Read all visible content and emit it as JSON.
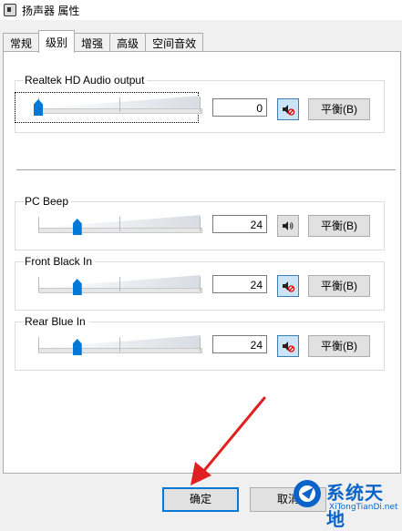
{
  "window": {
    "title": "扬声器 属性"
  },
  "tabs": [
    {
      "label": "常规"
    },
    {
      "label": "级别"
    },
    {
      "label": "增强"
    },
    {
      "label": "高级"
    },
    {
      "label": "空间音效"
    }
  ],
  "channels": [
    {
      "name": "Realtek HD Audio output",
      "value": "0",
      "level": 0,
      "muted": true,
      "balance_label": "平衡(B)"
    },
    {
      "name": "PC Beep",
      "value": "24",
      "level": 24,
      "muted": false,
      "balance_label": "平衡(B)"
    },
    {
      "name": "Front Black In",
      "value": "24",
      "level": 24,
      "muted": true,
      "balance_label": "平衡(B)"
    },
    {
      "name": "Rear Blue In",
      "value": "24",
      "level": 24,
      "muted": true,
      "balance_label": "平衡(B)"
    }
  ],
  "buttons": {
    "ok": "确定",
    "cancel": "取消"
  },
  "watermark": {
    "title": "系统天地",
    "sub": "XiTongTianDi.net"
  },
  "colors": {
    "accent": "#0078d7",
    "annotation": "#e02020",
    "watermark": "#0a63c9"
  }
}
